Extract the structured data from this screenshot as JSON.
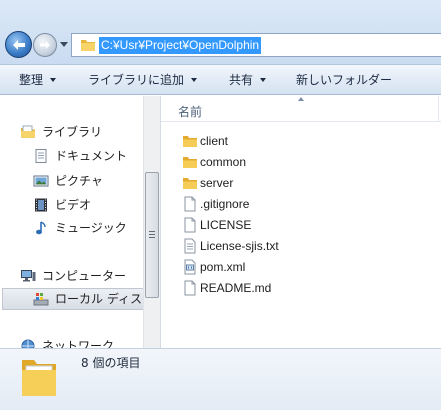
{
  "address_bar": {
    "path": "C:¥Usr¥Project¥OpenDolphin"
  },
  "command_bar": {
    "organize": "整理",
    "include_in_library": "ライブラリに追加",
    "share": "共有",
    "new_folder": "新しいフォルダー"
  },
  "navigation": {
    "library": "ライブラリ",
    "documents": "ドキュメント",
    "pictures": "ピクチャ",
    "videos": "ビデオ",
    "music": "ミュージック",
    "computer": "コンピューター",
    "local_disk": "ローカル ディス",
    "network": "ネットワーク"
  },
  "file_list": {
    "column_name": "名前",
    "items": [
      {
        "name": "client",
        "icon": "folder-icon"
      },
      {
        "name": "common",
        "icon": "folder-icon"
      },
      {
        "name": "server",
        "icon": "folder-icon"
      },
      {
        "name": ".gitignore",
        "icon": "file-icon"
      },
      {
        "name": "LICENSE",
        "icon": "file-icon"
      },
      {
        "name": "License-sjis.txt",
        "icon": "text-file-icon"
      },
      {
        "name": "pom.xml",
        "icon": "xml-file-icon"
      },
      {
        "name": "README.md",
        "icon": "file-icon"
      }
    ]
  },
  "details_pane": {
    "item_count": "8 個の項目"
  },
  "colors": {
    "selection": "#3399ff",
    "folder": "#f2c94c"
  }
}
